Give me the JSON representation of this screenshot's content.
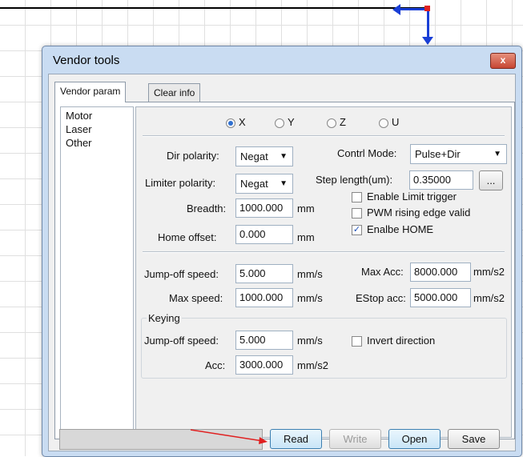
{
  "window": {
    "title": "Vendor tools",
    "close_label": "x"
  },
  "tabs": [
    {
      "label": "Vendor param",
      "active": true
    },
    {
      "label": "Clear info",
      "active": false
    }
  ],
  "sidebar": {
    "items": [
      {
        "label": "Motor"
      },
      {
        "label": "Laser"
      },
      {
        "label": "Other"
      }
    ]
  },
  "axis": {
    "options": [
      "X",
      "Y",
      "Z",
      "U"
    ],
    "selected": "X"
  },
  "motor": {
    "dir_polarity": {
      "label": "Dir polarity:",
      "value": "Negat"
    },
    "control_mode": {
      "label": "Contrl Mode:",
      "value": "Pulse+Dir"
    },
    "limiter_polarity": {
      "label": "Limiter polarity:",
      "value": "Negat"
    },
    "step_length": {
      "label": "Step length(um):",
      "value": "0.35000",
      "browse": "..."
    },
    "breadth": {
      "label": "Breadth:",
      "value": "1000.000",
      "unit": "mm"
    },
    "home_offset": {
      "label": "Home offset:",
      "value": "0.000",
      "unit": "mm"
    },
    "enable_limit_trigger": {
      "label": "Enable Limit trigger",
      "checked": false
    },
    "pwm_rising_edge": {
      "label": "PWM rising edge valid",
      "checked": false
    },
    "enable_home": {
      "label": "Enalbe HOME",
      "checked": true
    },
    "jump_off_speed": {
      "label": "Jump-off speed:",
      "value": "5.000",
      "unit": "mm/s"
    },
    "max_speed": {
      "label": "Max speed:",
      "value": "1000.000",
      "unit": "mm/s"
    },
    "max_acc": {
      "label": "Max Acc:",
      "value": "8000.000",
      "unit": "mm/s2"
    },
    "estop_acc": {
      "label": "EStop acc:",
      "value": "5000.000",
      "unit": "mm/s2"
    }
  },
  "keying": {
    "title": "Keying",
    "jump_off_speed": {
      "label": "Jump-off speed:",
      "value": "5.000",
      "unit": "mm/s"
    },
    "acc": {
      "label": "Acc:",
      "value": "3000.000",
      "unit": "mm/s2"
    },
    "invert_direction": {
      "label": "Invert direction",
      "checked": false
    }
  },
  "footer": {
    "read": "Read",
    "write": "Write",
    "open": "Open",
    "save": "Save"
  },
  "colors": {
    "axis_blue": "#1a3fd6",
    "axis_red": "#e02020",
    "annotation_red": "#e02020"
  }
}
